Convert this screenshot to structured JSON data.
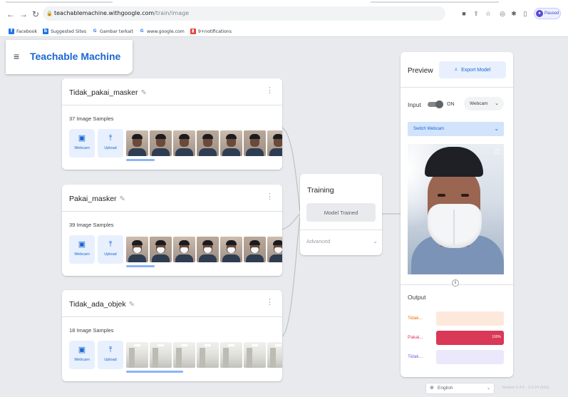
{
  "browser": {
    "back_icon": "arrow-left-icon",
    "forward_icon": "arrow-right-icon",
    "reload_icon": "reload-icon",
    "url_host": "teachablemachine.withgoogle.com",
    "url_path": "/train/image",
    "profile_label": "Paused",
    "bookmarks": [
      "Facebook",
      "Suggested Sites",
      "Gambar terkait",
      "www.google.com",
      "9+notifications"
    ]
  },
  "app": {
    "title": "Teachable Machine",
    "brand_color": "#1967d2"
  },
  "classes": [
    {
      "name": "Tidak_pakai_masker",
      "samples": "37 Image Samples",
      "thumb_type": "face"
    },
    {
      "name": "Pakai_masker",
      "samples": "39 Image Samples",
      "thumb_type": "masked"
    },
    {
      "name": "Tidak_ada_objek",
      "samples": "18 Image Samples",
      "thumb_type": "room"
    }
  ],
  "sample_sources": {
    "webcam_label": "Webcam",
    "upload_label": "Upload"
  },
  "training": {
    "title": "Training",
    "button_label": "Model Trained",
    "advanced_label": "Advanced"
  },
  "preview": {
    "title": "Preview",
    "export_label": "Export Model",
    "input_label": "Input",
    "toggle_state": "ON",
    "input_source": "Webcam",
    "switch_webcam_label": "Switch Webcam",
    "output_label": "Output",
    "outputs": [
      {
        "label": "Tidak...",
        "percent": "",
        "fraction": 0,
        "color": "#e8710a",
        "track": "#fde9dc"
      },
      {
        "label": "Pakai...",
        "percent": "100%",
        "fraction": 1.0,
        "color": "#d93856",
        "track": "#fbd8de"
      },
      {
        "label": "Tidak...",
        "percent": "",
        "fraction": 0,
        "color": "#7b5cd6",
        "track": "#ece8fb"
      }
    ]
  },
  "footer": {
    "language": "English",
    "version": "Version 2.4.5 - 2.4.24 (b2s)"
  }
}
